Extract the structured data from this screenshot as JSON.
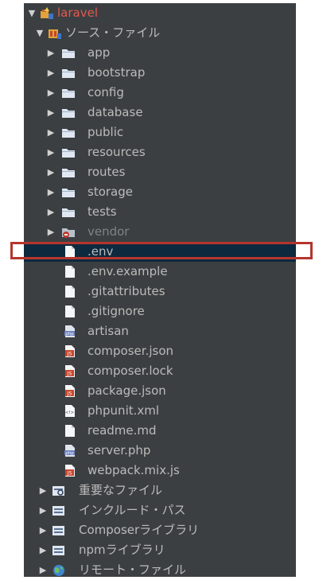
{
  "tree": {
    "project": {
      "label": "laravel"
    },
    "source_root": {
      "label": "ソース・ファイル"
    },
    "folders": [
      {
        "label": "app"
      },
      {
        "label": "bootstrap"
      },
      {
        "label": "config"
      },
      {
        "label": "database"
      },
      {
        "label": "public"
      },
      {
        "label": "resources"
      },
      {
        "label": "routes"
      },
      {
        "label": "storage"
      },
      {
        "label": "tests"
      },
      {
        "label": "vendor"
      }
    ],
    "files": [
      {
        "label": ".env",
        "icon": "file-icon",
        "selected": true
      },
      {
        "label": ".env.example",
        "icon": "file-icon"
      },
      {
        "label": ".gitattributes",
        "icon": "file-icon"
      },
      {
        "label": ".gitignore",
        "icon": "file-icon"
      },
      {
        "label": "artisan",
        "icon": "php-file-icon",
        "icon_text": "php"
      },
      {
        "label": "composer.json",
        "icon": "js-file-icon",
        "icon_text": "JS"
      },
      {
        "label": "composer.lock",
        "icon": "js-file-icon",
        "icon_text": "JS"
      },
      {
        "label": "package.json",
        "icon": "js-file-icon",
        "icon_text": "JS"
      },
      {
        "label": "phpunit.xml",
        "icon": "xml-file-icon",
        "icon_text": "<!>"
      },
      {
        "label": "readme.md",
        "icon": "file-icon"
      },
      {
        "label": "server.php",
        "icon": "php-file-icon",
        "icon_text": "php"
      },
      {
        "label": "webpack.mix.js",
        "icon": "js-file-icon",
        "icon_text": "JS"
      }
    ],
    "nodes": [
      {
        "label": "重要なファイル",
        "icon": "important-files-icon"
      },
      {
        "label": "インクルード・パス",
        "icon": "include-path-icon"
      },
      {
        "label": "Composerライブラリ",
        "icon": "library-icon"
      },
      {
        "label": "npmライブラリ",
        "icon": "library-icon"
      },
      {
        "label": "リモート・ファイル",
        "icon": "globe-icon"
      }
    ]
  },
  "colors": {
    "panel": "#3c3f41",
    "text": "#bbbbbb",
    "selection": "#0d293e",
    "highlight_frame": "#b5352d",
    "project_label": "#e05a4e"
  }
}
